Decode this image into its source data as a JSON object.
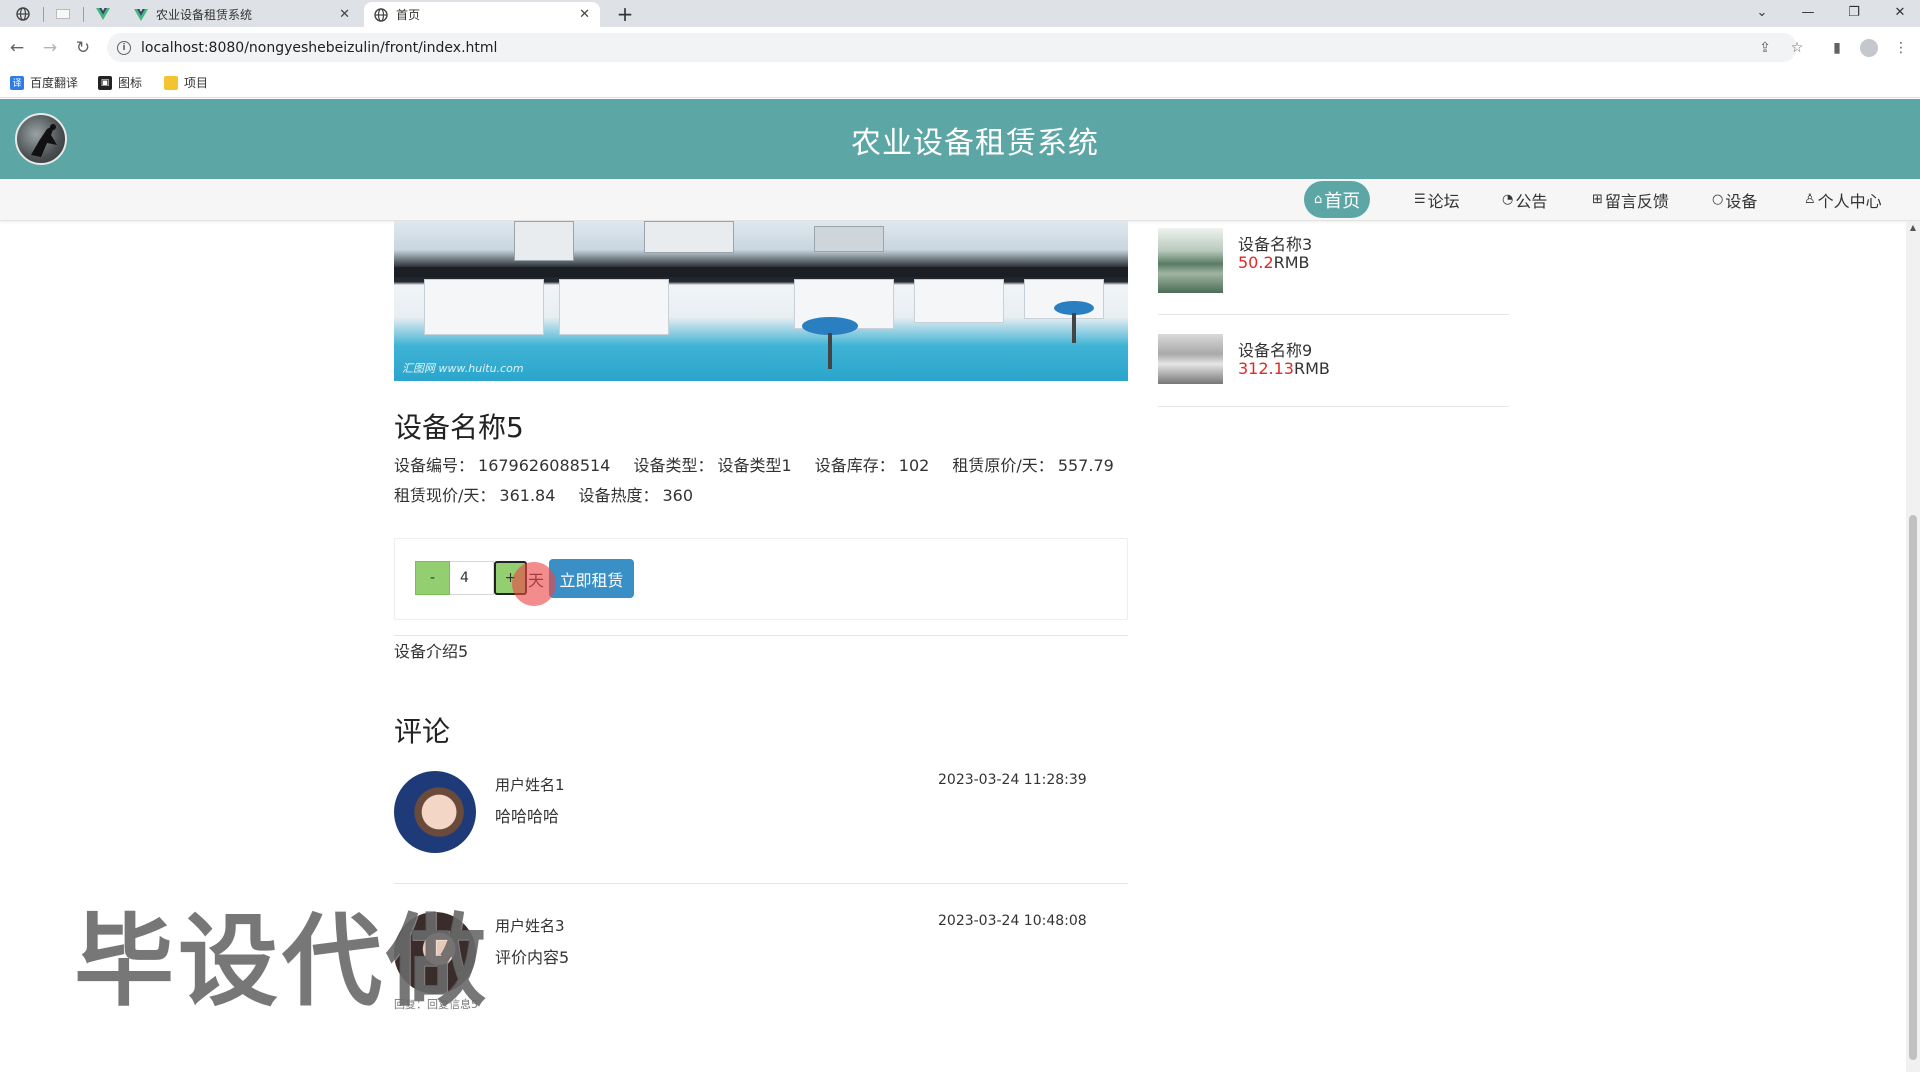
{
  "browser": {
    "tabs": [
      {
        "title": "农业设备租赁系统"
      },
      {
        "title": "首页"
      }
    ],
    "new_tab": "+",
    "url": "localhost:8080/nongyeshebeizulin/front/index.html",
    "bookmarks": [
      {
        "label": "百度翻译"
      },
      {
        "label": "图标"
      },
      {
        "label": "项目"
      }
    ]
  },
  "site": {
    "title": "农业设备租赁系统"
  },
  "nav": [
    {
      "label": "首页"
    },
    {
      "label": "论坛"
    },
    {
      "label": "公告"
    },
    {
      "label": "留言反馈"
    },
    {
      "label": "设备"
    },
    {
      "label": "个人中心"
    }
  ],
  "product": {
    "name": "设备名称5",
    "fields": {
      "code_label": "设备编号：",
      "code": "1679626088514",
      "type_label": "设备类型：",
      "type": "设备类型1",
      "stock_label": "设备库存：",
      "stock": "102",
      "orig_label": "租赁原价/天：",
      "orig": "557.79",
      "now_label": "租赁现价/天：",
      "now": "361.84",
      "heat_label": "设备热度：",
      "heat": "360"
    },
    "hero_watermark": "汇图网 www.huitu.com",
    "intro": "设备介绍5"
  },
  "rent": {
    "minus": "-",
    "quantity": "4",
    "plus": "+",
    "unit": "天",
    "button": "立即租赁"
  },
  "comments": {
    "title": "评论",
    "items": [
      {
        "user": "用户姓名1",
        "text": "哈哈哈哈",
        "time": "2023-03-24 11:28:39"
      },
      {
        "user": "用户姓名3",
        "text": "评价内容5",
        "time": "2023-03-24 10:48:08"
      }
    ],
    "reply": "回复：回复信息5"
  },
  "sidebar": {
    "items": [
      {
        "name": "设备名称3",
        "price": "50.2",
        "unit": "RMB"
      },
      {
        "name": "设备名称9",
        "price": "312.13",
        "unit": "RMB"
      }
    ]
  },
  "overlay": {
    "text": "毕设代做"
  },
  "colors": {
    "header": "#5da6a6",
    "price": "#e02828",
    "rent_button": "#3b8fc7",
    "stepper": "#93cf71"
  }
}
